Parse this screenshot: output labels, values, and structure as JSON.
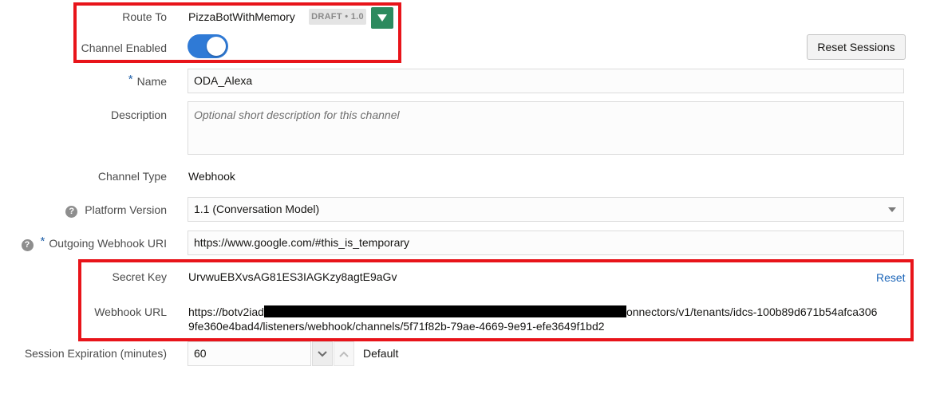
{
  "route_to": {
    "label": "Route To",
    "value": "PizzaBotWithMemory",
    "badge": "DRAFT • 1.0",
    "dropdown_icon": "triangle-down-icon"
  },
  "channel_enabled": {
    "label": "Channel Enabled",
    "value": true
  },
  "reset_sessions_label": "Reset Sessions",
  "name": {
    "required_mark": "*",
    "label": "Name",
    "value": "ODA_Alexa"
  },
  "description": {
    "label": "Description",
    "placeholder": "Optional short description for this channel",
    "value": ""
  },
  "channel_type": {
    "label": "Channel Type",
    "value": "Webhook"
  },
  "platform_version": {
    "help": "?",
    "label": "Platform Version",
    "value": "1.1 (Conversation Model)"
  },
  "outgoing_webhook": {
    "help": "?",
    "required_mark": "*",
    "label": "Outgoing Webhook URI",
    "value": "https://www.google.com/#this_is_temporary"
  },
  "secret_key": {
    "label": "Secret Key",
    "value": "UrvwuEBXvsAG81ES3IAGKzy8agtE9aGv",
    "reset_label": "Reset"
  },
  "webhook_url": {
    "label": "Webhook URL",
    "line1_prefix": "https://botv2iad",
    "line1_suffix": "onnectors/v1/tenants/idcs-100b89d671b54afca306",
    "line2": "9fe360e4bad4/listeners/webhook/channels/5f71f82b-79ae-4669-9e91-efe3649f1bd2"
  },
  "session_expiration": {
    "label": "Session Expiration (minutes)",
    "value": "60",
    "default_label": "Default"
  },
  "colors": {
    "highlight": "#e8141a",
    "toggle_on": "#2f7ad6",
    "dropdown_btn": "#2c8a5e",
    "link": "#1a64b8"
  }
}
